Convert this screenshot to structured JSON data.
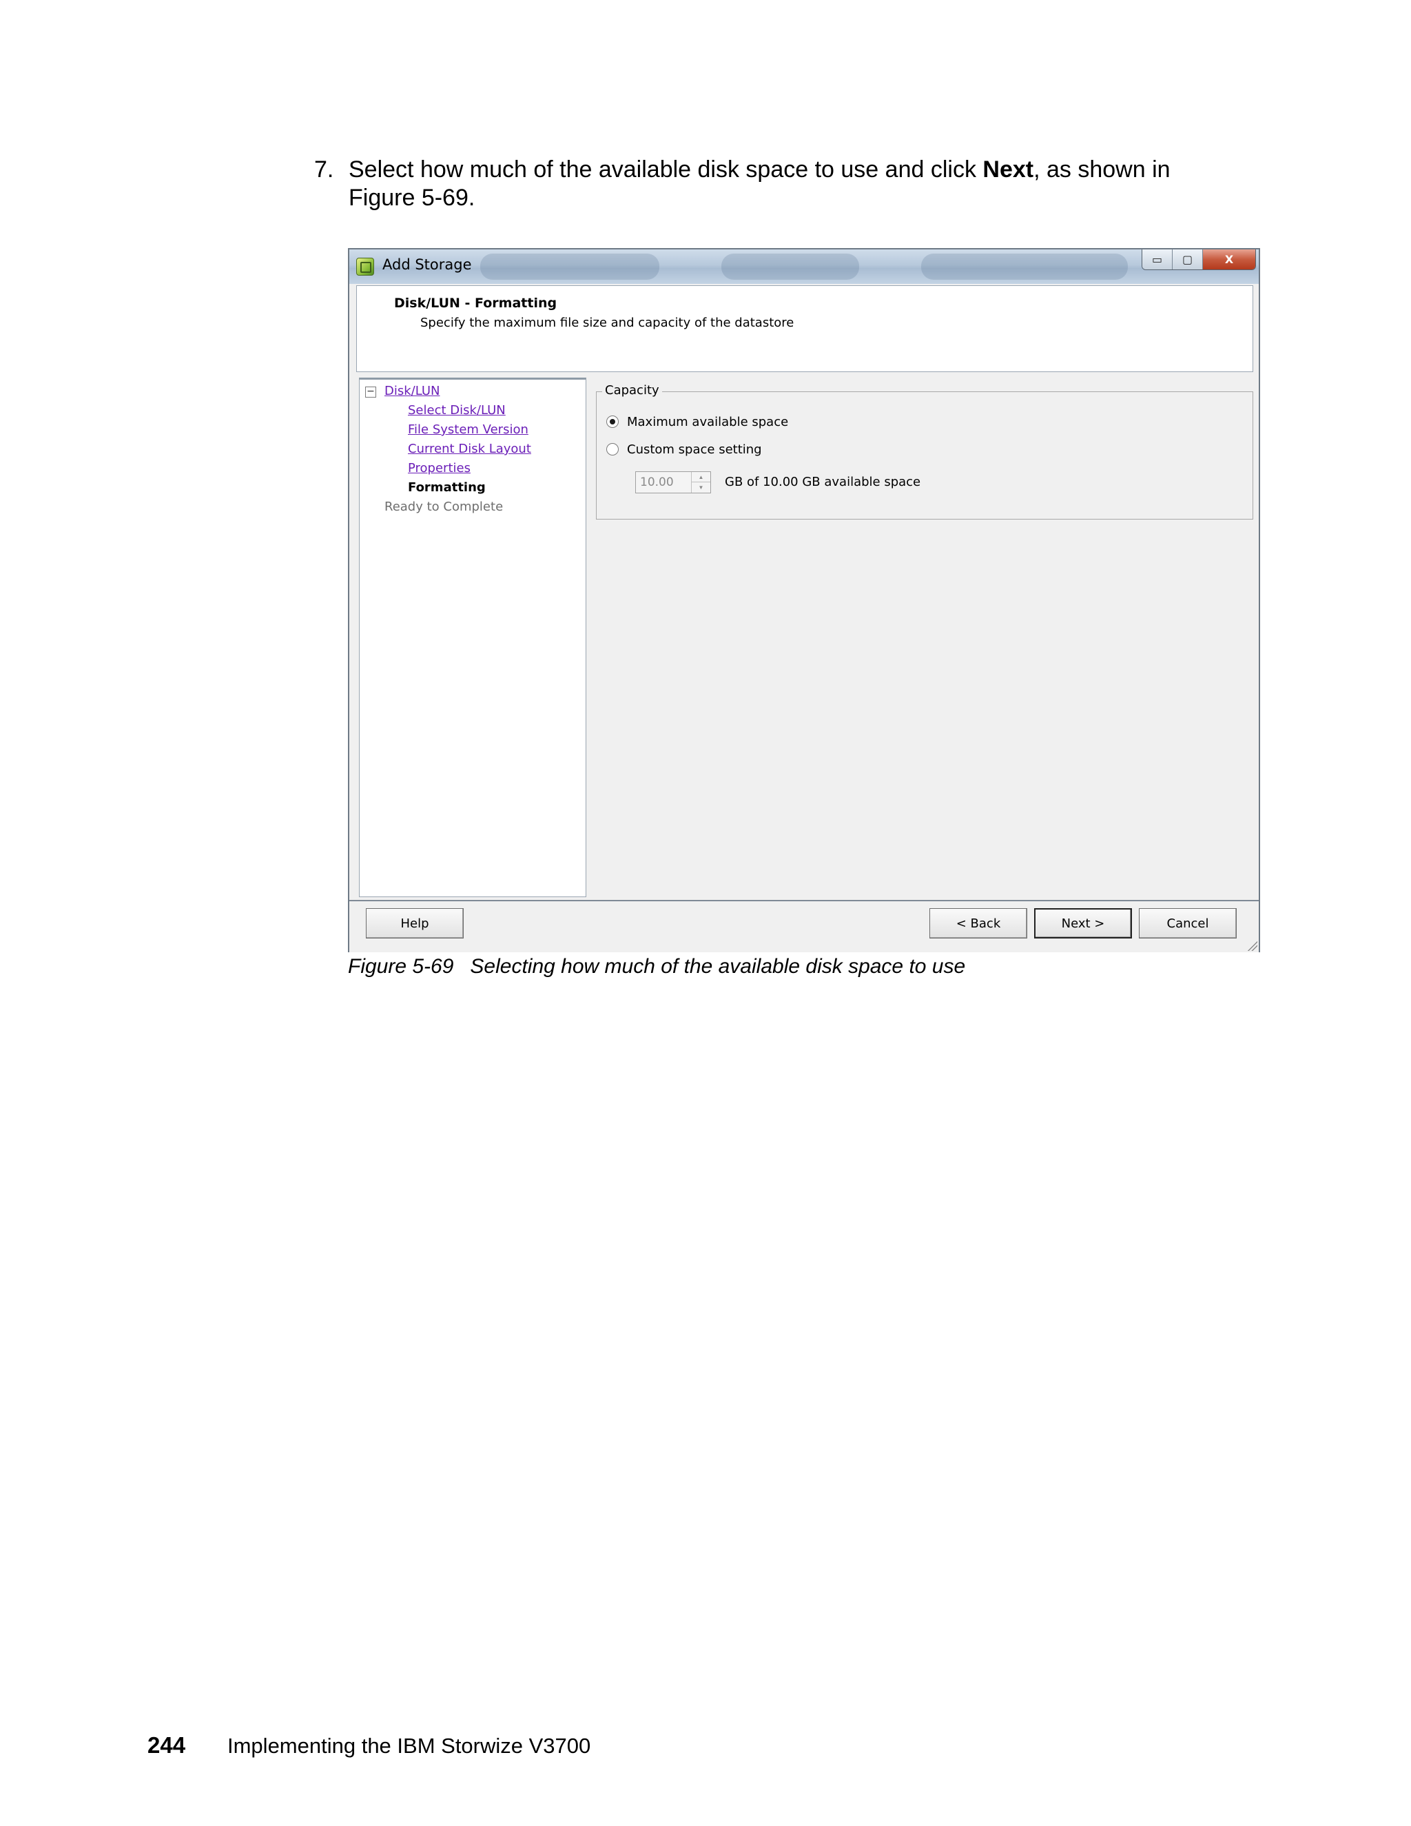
{
  "step": {
    "number": "7.",
    "text_before": "Select how much of the available disk space to use and click ",
    "text_bold": "Next",
    "text_after": ", as shown in Figure 5-69."
  },
  "dialog": {
    "title": "Add Storage",
    "window_buttons": {
      "minimize": "▭",
      "maximize": "▢",
      "close": "X"
    },
    "header": {
      "title": "Disk/LUN - Formatting",
      "subtitle": "Specify the maximum file size and capacity of the datastore"
    },
    "nav": {
      "collapse_symbol": "−",
      "root": "Disk/LUN",
      "items": [
        {
          "label": "Select Disk/LUN",
          "state": "link"
        },
        {
          "label": "File System Version",
          "state": "link"
        },
        {
          "label": "Current Disk Layout",
          "state": "link"
        },
        {
          "label": "Properties",
          "state": "link"
        },
        {
          "label": "Formatting",
          "state": "current"
        }
      ],
      "pending": "Ready to Complete"
    },
    "capacity": {
      "legend": "Capacity",
      "option_max": "Maximum available space",
      "option_custom": "Custom space setting",
      "selected": "max",
      "custom_value": "10.00",
      "available_text": "GB of 10.00 GB available space"
    },
    "buttons": {
      "help": "Help",
      "back": "< Back",
      "next": "Next >",
      "cancel": "Cancel"
    }
  },
  "caption": {
    "label": "Figure 5-69",
    "text": "Selecting how much of the available disk space to use"
  },
  "page_footer": {
    "page_number": "244",
    "book_title": "Implementing the IBM Storwize V3700"
  }
}
